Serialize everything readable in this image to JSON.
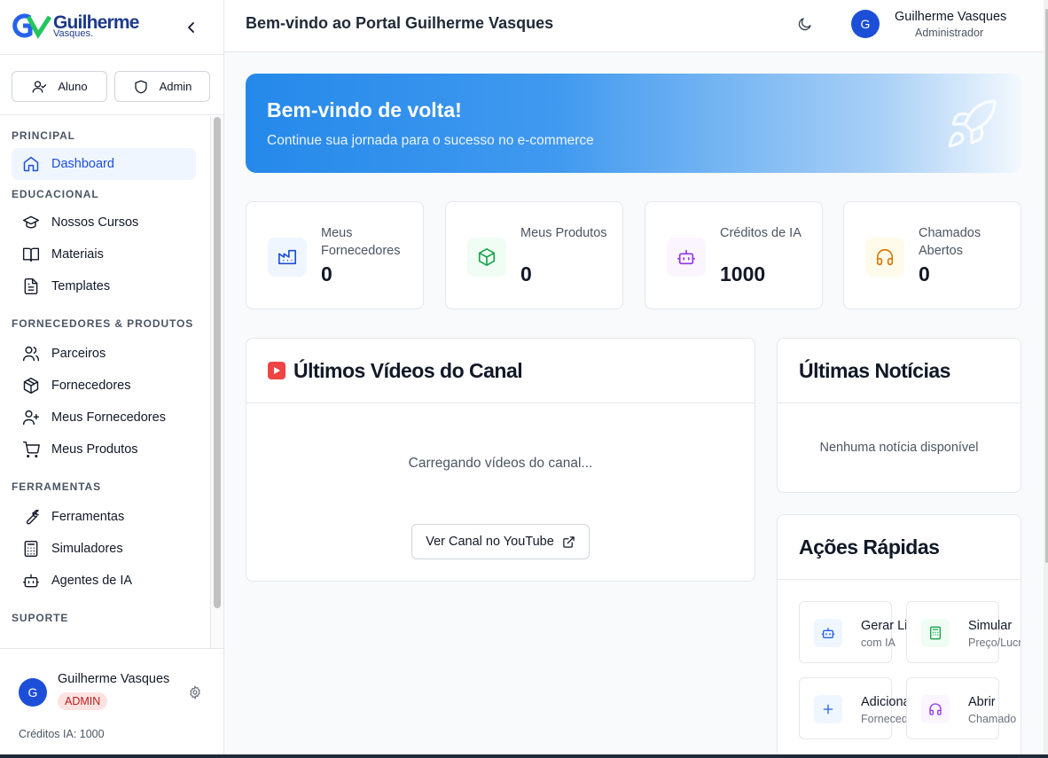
{
  "sidebar": {
    "logo": {
      "name": "Guilherme",
      "sub": "Vasques."
    },
    "roles": {
      "student": "Aluno",
      "admin": "Admin"
    },
    "sections": {
      "principal": "PRINCIPAL",
      "educacional": "EDUCACIONAL",
      "fornecedores": "FORNECEDORES & PRODUTOS",
      "ferramentas": "FERRAMENTAS",
      "suporte": "SUPORTE"
    },
    "items": {
      "dashboard": "Dashboard",
      "cursos": "Nossos Cursos",
      "materiais": "Materiais",
      "templates": "Templates",
      "parceiros": "Parceiros",
      "fornecedores": "Fornecedores",
      "meus_fornecedores": "Meus Fornecedores",
      "meus_produtos": "Meus Produtos",
      "ferramentas": "Ferramentas",
      "simuladores": "Simuladores",
      "agentes": "Agentes de IA"
    },
    "footer": {
      "initial": "G",
      "name": "Guilherme Vasques",
      "badge": "ADMIN",
      "credits": "Créditos IA: 1000"
    }
  },
  "header": {
    "title": "Bem-vindo ao Portal Guilherme Vasques",
    "user_initial": "G",
    "user_name": "Guilherme Vasques",
    "user_role": "Administrador"
  },
  "hero": {
    "title": "Bem-vindo de volta!",
    "subtitle": "Continue sua jornada para o sucesso no e-commerce"
  },
  "stats": [
    {
      "label": "Meus Fornecedores",
      "value": "0",
      "icon": "factory-icon",
      "color": "#1d4ed8"
    },
    {
      "label": "Meus Produtos",
      "value": "0",
      "icon": "package-icon",
      "color": "#16a34a"
    },
    {
      "label": "Créditos de IA",
      "value": "1000",
      "icon": "bot-icon",
      "color": "#9333ea"
    },
    {
      "label": "Chamados Abertos",
      "value": "0",
      "icon": "headphones-icon",
      "color": "#d97706"
    }
  ],
  "videos": {
    "title": "Últimos Vídeos do Canal",
    "loading": "Carregando vídeos do canal...",
    "button": "Ver Canal no YouTube"
  },
  "news": {
    "title": "Últimas Notícias",
    "empty": "Nenhuma notícia disponível"
  },
  "quick_actions": {
    "title": "Ações Rápidas",
    "items": [
      {
        "title": "Gerar Listagem",
        "subtitle": "com IA",
        "icon": "bot-icon"
      },
      {
        "title": "Simular",
        "subtitle": "Preço/Lucro",
        "icon": "calculator-icon"
      },
      {
        "title": "Adicionar",
        "subtitle": "Fornecedor",
        "icon": "plus-icon"
      },
      {
        "title": "Abrir",
        "subtitle": "Chamado",
        "icon": "headphones-icon"
      }
    ]
  }
}
